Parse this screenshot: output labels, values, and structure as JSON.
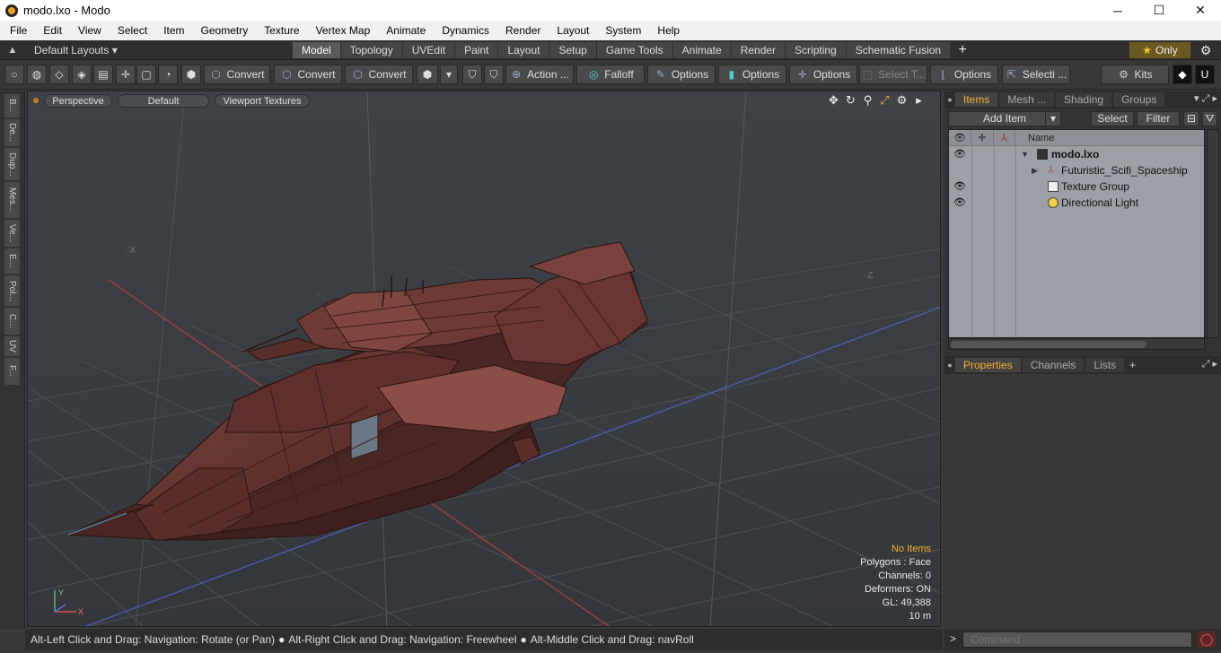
{
  "window": {
    "title": "modo.lxo - Modo",
    "minimize": "─",
    "maximize": "☐",
    "close": "✕"
  },
  "menu": [
    "File",
    "Edit",
    "View",
    "Select",
    "Item",
    "Geometry",
    "Texture",
    "Vertex Map",
    "Animate",
    "Dynamics",
    "Render",
    "Layout",
    "System",
    "Help"
  ],
  "layoutbar": {
    "layouts_label": "Default Layouts ▾",
    "tabs": [
      "Model",
      "Topology",
      "UVEdit",
      "Paint",
      "Layout",
      "Setup",
      "Game Tools",
      "Animate",
      "Render",
      "Scripting",
      "Schematic Fusion"
    ],
    "active_tab": "Model",
    "only_label": "Only"
  },
  "toolbar": {
    "convert1": "Convert",
    "convert2": "Convert",
    "convert3": "Convert",
    "action": "Action  ...",
    "falloff": "Falloff",
    "options1": "Options",
    "options2": "Options",
    "options3": "Options",
    "select_t": "Select T...",
    "options4": "Options",
    "selecti": "Selecti ...",
    "kits": "Kits"
  },
  "left_tabs": [
    "B...",
    "De...",
    "Dup...",
    "Mes...",
    "Ve...",
    "E...",
    "Pol...",
    "C...",
    "UV",
    "F..."
  ],
  "viewport": {
    "view_mode": "Perspective",
    "shading": "Default",
    "textures": "Viewport Textures",
    "axis_x": "-X",
    "axis_z": "-Z",
    "stats": {
      "items": "No Items",
      "polygons": "Polygons : Face",
      "channels": "Channels: 0",
      "deformers": "Deformers: ON",
      "gl": "GL: 49,388",
      "scale": "10 m"
    },
    "gizmo_x": "X",
    "gizmo_y": "Y"
  },
  "statusbar": {
    "hint1": "Alt-Left Click and Drag: Navigation: Rotate (or Pan)",
    "hint2": "Alt-Right Click and Drag: Navigation: Freewheel",
    "hint3": "Alt-Middle Click and Drag: navRoll"
  },
  "items_panel": {
    "tabs": [
      "Items",
      "Mesh ...",
      "Shading",
      "Groups"
    ],
    "active_tab": "Items",
    "add_item": "Add Item",
    "select": "Select",
    "filter": "Filter",
    "name_col": "Name",
    "rows": [
      {
        "label": "modo.lxo",
        "bold": true,
        "visible": true
      },
      {
        "label": "Futuristic_Scifi_Spaceship",
        "bold": false,
        "visible": false
      },
      {
        "label": "Texture Group",
        "bold": false,
        "visible": true
      },
      {
        "label": "Directional Light",
        "bold": false,
        "visible": true
      }
    ]
  },
  "props_panel": {
    "tabs": [
      "Properties",
      "Channels",
      "Lists"
    ],
    "active_tab": "Properties"
  },
  "command": {
    "prompt": ">",
    "placeholder": "Command"
  },
  "colors": {
    "accent": "#f0b030",
    "viewport_bg": "#3b3f43",
    "ship": "#6e3a36"
  }
}
